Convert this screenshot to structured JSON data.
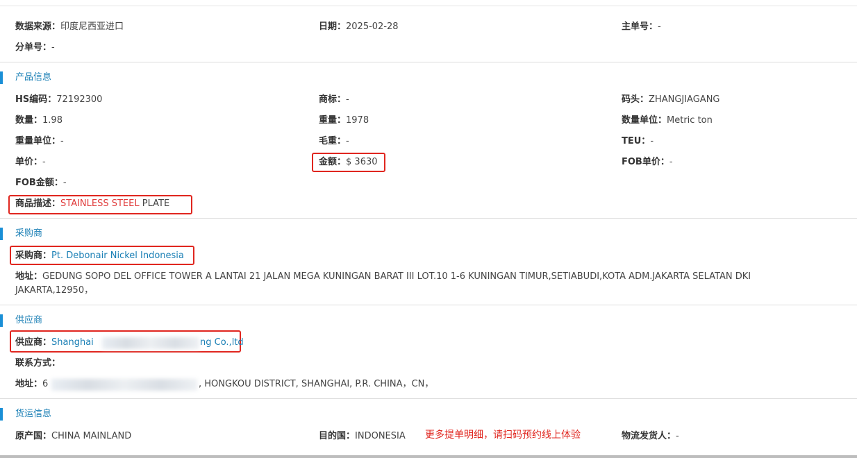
{
  "header": {
    "source_label": "数据来源：",
    "source_value": "印度尼西亚进口",
    "date_label": "日期：",
    "date_value": "2025-02-28",
    "master_label": "主单号：",
    "master_value": "-",
    "sub_label": "分单号：",
    "sub_value": "-"
  },
  "product": {
    "title": "产品信息",
    "hs_label": "HS编码：",
    "hs_value": "72192300",
    "brand_label": "商标：",
    "brand_value": "-",
    "port_label": "码头：",
    "port_value": "ZHANGJIAGANG",
    "qty_label": "数量：",
    "qty_value": "1.98",
    "weight_label": "重量：",
    "weight_value": "1978",
    "qty_unit_label": "数量单位：",
    "qty_unit_value": "Metric ton",
    "weight_unit_label": "重量单位：",
    "weight_unit_value": "-",
    "gross_label": "毛重：",
    "gross_value": "-",
    "teu_label": "TEU：",
    "teu_value": "-",
    "price_label": "单价：",
    "price_value": "-",
    "amount_label": "金额：",
    "amount_value": "$ 3630",
    "fob_price_label": "FOB单价：",
    "fob_price_value": "-",
    "fob_amount_label": "FOB金额：",
    "fob_amount_value": "-",
    "desc_label": "商品描述：",
    "desc_highlight": "STAINLESS STEEL",
    "desc_rest": " PLATE"
  },
  "buyer": {
    "title": "采购商",
    "name_label": "采购商：",
    "name_value": "Pt. Debonair Nickel Indonesia",
    "addr_label": "地址：",
    "addr_value": "GEDUNG SOPO DEL OFFICE TOWER A LANTAI 21 JALAN MEGA KUNINGAN BARAT III LOT.10 1-6 KUNINGAN TIMUR,SETIABUDI,KOTA ADM.JAKARTA SELATAN DKI JAKARTA,12950，"
  },
  "supplier": {
    "title": "供应商",
    "name_label": "供应商：",
    "name_start": "Shanghai",
    "name_end": "ng Co.,ltd",
    "contact_label": "联系方式：",
    "addr_label": "地址：",
    "addr_start": "6",
    "addr_end": ", HONGKOU DISTRICT, SHANGHAI, P.R. CHINA，CN，"
  },
  "shipping": {
    "title": "货运信息",
    "origin_label": "原产国：",
    "origin_value": "CHINA MAINLAND",
    "dest_label": "目的国：",
    "dest_value": "INDONESIA",
    "promo": "更多提单明细，请扫码预约线上体验",
    "shipper_label": "物流发货人：",
    "shipper_value": "-"
  },
  "colors": {
    "accent": "#1a8fd6",
    "link": "#1a7fb5",
    "highlight_box": "#e0261f"
  }
}
